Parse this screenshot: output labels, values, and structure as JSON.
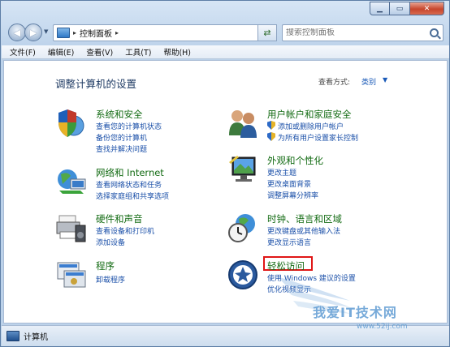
{
  "window": {
    "caption_buttons": [
      "minimize",
      "maximize",
      "close"
    ]
  },
  "nav": {
    "back_icon": "back-arrow-icon",
    "forward_icon": "forward-arrow-icon"
  },
  "address": {
    "path": "控制面板"
  },
  "search": {
    "placeholder": "搜索控制面板"
  },
  "menu": [
    "文件(F)",
    "编辑(E)",
    "查看(V)",
    "工具(T)",
    "帮助(H)"
  ],
  "content": {
    "title": "调整计算机的设置",
    "view_by_label": "查看方式:",
    "view_by_value": "类别"
  },
  "categories": {
    "left": [
      {
        "title": "系统和安全",
        "icon": "shield-globe-icon",
        "links": [
          "查看您的计算机状态",
          "备份您的计算机",
          "查找并解决问题"
        ]
      },
      {
        "title": "网络和 Internet",
        "icon": "network-globe-icon",
        "links": [
          "查看网络状态和任务",
          "选择家庭组和共享选项"
        ]
      },
      {
        "title": "硬件和声音",
        "icon": "printer-speaker-icon",
        "links": [
          "查看设备和打印机",
          "添加设备"
        ]
      },
      {
        "title": "程序",
        "icon": "programs-icon",
        "links": [
          "卸载程序"
        ]
      }
    ],
    "right": [
      {
        "title": "用户帐户和家庭安全",
        "icon": "users-icon",
        "links": [
          "添加或删除用户帐户",
          "为所有用户设置家长控制"
        ]
      },
      {
        "title": "外观和个性化",
        "icon": "monitor-icon",
        "links": [
          "更改主题",
          "更改桌面背景",
          "调整屏幕分辨率"
        ]
      },
      {
        "title": "时钟、语言和区域",
        "icon": "clock-globe-icon",
        "links": [
          "更改键盘或其他输入法",
          "更改显示语言"
        ]
      },
      {
        "title": "轻松访问",
        "icon": "ease-of-access-icon",
        "links": [
          "使用 Windows 建议的设置",
          "优化视频显示"
        ]
      }
    ]
  },
  "statusbar": {
    "text": "计算机"
  },
  "watermark": {
    "text": "我爱IT技术网",
    "url": "www.52ij.com"
  },
  "colors": {
    "category_title": "#136b13",
    "link": "#1a4fa8",
    "highlight": "#e01616"
  }
}
